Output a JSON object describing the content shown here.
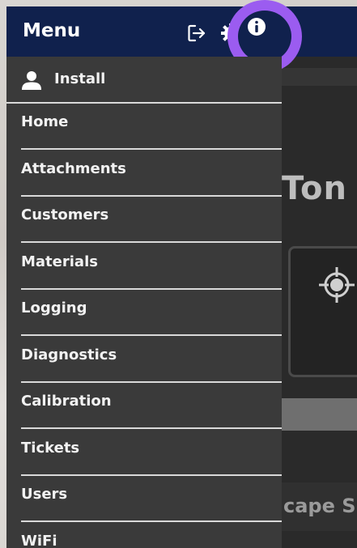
{
  "header": {
    "title": "Menu",
    "icons": [
      "logout-icon",
      "gear-icon",
      "info-icon"
    ]
  },
  "drawer": {
    "install_label": "Install",
    "items": [
      {
        "label": "Home"
      },
      {
        "label": "Attachments"
      },
      {
        "label": "Customers"
      },
      {
        "label": "Materials"
      },
      {
        "label": "Logging"
      },
      {
        "label": "Diagnostics"
      },
      {
        "label": "Calibration"
      },
      {
        "label": "Tickets"
      },
      {
        "label": "Users"
      },
      {
        "label": "WiFi"
      }
    ]
  },
  "background": {
    "ton_text": "Ton",
    "escape_text": "cape S"
  },
  "colors": {
    "header": "#10214d",
    "drawer": "#3a3a3a",
    "highlight": "#9b5cf0"
  }
}
